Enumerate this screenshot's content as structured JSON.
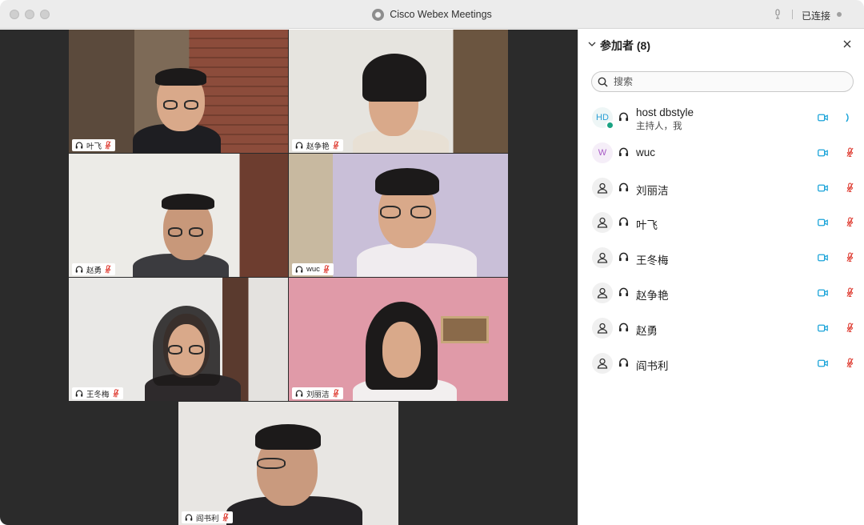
{
  "window": {
    "title": "Cisco Webex Meetings",
    "connection_status": "已连接"
  },
  "video_tiles": [
    {
      "name": "叶飞",
      "muted": true
    },
    {
      "name": "赵争艳",
      "muted": true
    },
    {
      "name": "赵勇",
      "muted": true
    },
    {
      "name": "wuc",
      "muted": true
    },
    {
      "name": "王冬梅",
      "muted": true
    },
    {
      "name": "刘丽洁",
      "muted": true
    },
    {
      "name": "阎书利",
      "muted": true
    }
  ],
  "panel": {
    "title": "参加者 (8)",
    "search_placeholder": "搜索",
    "participants": [
      {
        "name": "host dbstyle",
        "subtitle": "主持人，我",
        "avatar": "HD",
        "status": "speaking"
      },
      {
        "name": "wuc",
        "avatar": "W",
        "status": "muted"
      },
      {
        "name": "刘丽洁",
        "avatar": "person-icon",
        "status": "muted"
      },
      {
        "name": "叶飞",
        "avatar": "person-icon",
        "status": "muted"
      },
      {
        "name": "王冬梅",
        "avatar": "person-icon",
        "status": "muted"
      },
      {
        "name": "赵争艳",
        "avatar": "person-icon",
        "status": "muted"
      },
      {
        "name": "赵勇",
        "avatar": "person-icon",
        "status": "muted"
      },
      {
        "name": "阎书利",
        "avatar": "person-icon",
        "status": "muted"
      }
    ]
  },
  "colors": {
    "accent": "#1ba4d9",
    "muted_red": "#e0443a",
    "video_bg": "#2b2b2b"
  }
}
